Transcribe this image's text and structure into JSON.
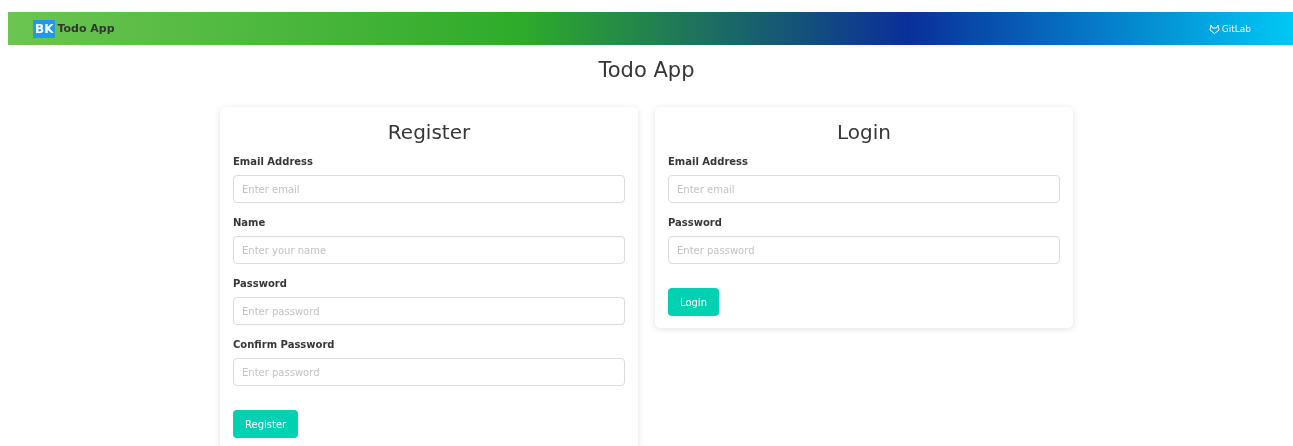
{
  "navbar": {
    "logo": "BK",
    "brand": "Todo App",
    "link": "GitLab"
  },
  "page_title": "Todo App",
  "forms": [
    {
      "title": "Register",
      "fields": [
        {
          "label": "Email Address",
          "placeholder": "Enter email"
        },
        {
          "label": "Name",
          "placeholder": "Enter your name"
        },
        {
          "label": "Password",
          "placeholder": "Enter password"
        },
        {
          "label": "Confirm Password",
          "placeholder": "Enter password"
        }
      ],
      "button": "Register"
    },
    {
      "title": "Login",
      "fields": [
        {
          "label": "Email Address",
          "placeholder": "Enter email"
        },
        {
          "label": "Password",
          "placeholder": "Enter password"
        }
      ],
      "button": "Login"
    }
  ]
}
